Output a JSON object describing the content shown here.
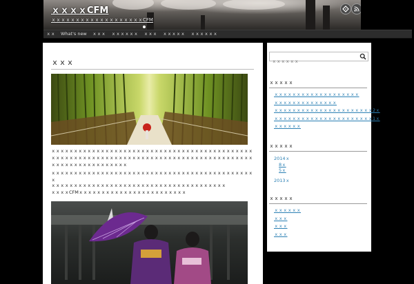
{
  "header": {
    "site_title": "ｘｘｘｘCFM",
    "site_description": "ｘｘｘｘｘｘｘｘｘｘｘｘｘｘｘｘｘｘｘCFM"
  },
  "nav": {
    "items": [
      {
        "label": "ｘｘ"
      },
      {
        "label": "What's new"
      },
      {
        "label": "ｘｘｘ"
      },
      {
        "label": "ｘｘｘｘｘｘ"
      },
      {
        "label": "ｘｘｘ"
      },
      {
        "label": "ｘｘｘｘｘ"
      },
      {
        "label": "ｘｘｘｘｘｘ"
      }
    ]
  },
  "main": {
    "title": "ｘｘｘ",
    "paragraph1": "ｘｘｘｘｘｘｘｘｘｘｘｘｘｘｘｘｘｘｘｘｘｘｘｘｘｘｘｘｘｘｘｘｘｘｘｘｘｘｘｘｘｘｘｘｘｘｘｘｘｘｘｘｘｘｘｘｘｘｘｘｘｘｘｘｘｘｘｘｘｘｘｘｘｘｘｘｘｘｘｘｘｘｘｘｘｘｘｘｘｘｘｘｘｘｘｘｘｘｘｘｘｘｘｘｘｘｘ",
    "paragraph2": "ｘｘｘｘｘｘｘｘｘｘｘｘｘｘｘｘｘｘｘｘｘｘｘｘｘｘｘｘｘｘｘｘｘｘｘｘｘｘｘｘｘｘｘｘｘｘ",
    "paragraph3_line1": "ｘｘｘｘｘｘｘｘｘｘｘｘｘｘｘｘｘｘｘｘｘｘｘｘｘｘｘｘｘｘｘｘｘｘｘｘｘｘｘ",
    "paragraph3_line2": "ｘｘｘｘCFMｘｘｘｘｘｘｘｘｘｘｘｘｘｘｘｘｘｘｘｘｘｘｘｘ"
  },
  "sidebar": {
    "search_placeholder": "ｘｘｘｘｘｘ",
    "recent_title": "ｘｘｘｘｘ",
    "recent_links": [
      "ｘｘｘｘｘｘｘｘｘｘｘｘｘｘｘｘｘｘｘ",
      "ｘｘｘｘｘｘｘｘｘｘｘｘｘｘ",
      "ｘｘｘｘｘｘｘｘｘｘｘｘｘｘｘｘｘｘｘｘｘｘ2ｘ",
      "ｘｘｘｘｘｘｘｘｘｘｘｘｘｘｘｘｘｘｘｘｘｘ1ｘ",
      "ｘｘｘｘｘｘ"
    ],
    "archive_title": "ｘｘｘｘｘ",
    "archive_year_1": "2014ｘ",
    "archive_month_1": "8ｘ",
    "archive_month_2": "5ｘ",
    "archive_year_2": "2013ｘ",
    "category_title": "ｘｘｘｘｘ",
    "category_links": [
      "ｘｘｘｘｘｘ",
      "ｘｘｘ",
      "ｘｘｘ",
      "ｘｘｘ"
    ]
  }
}
